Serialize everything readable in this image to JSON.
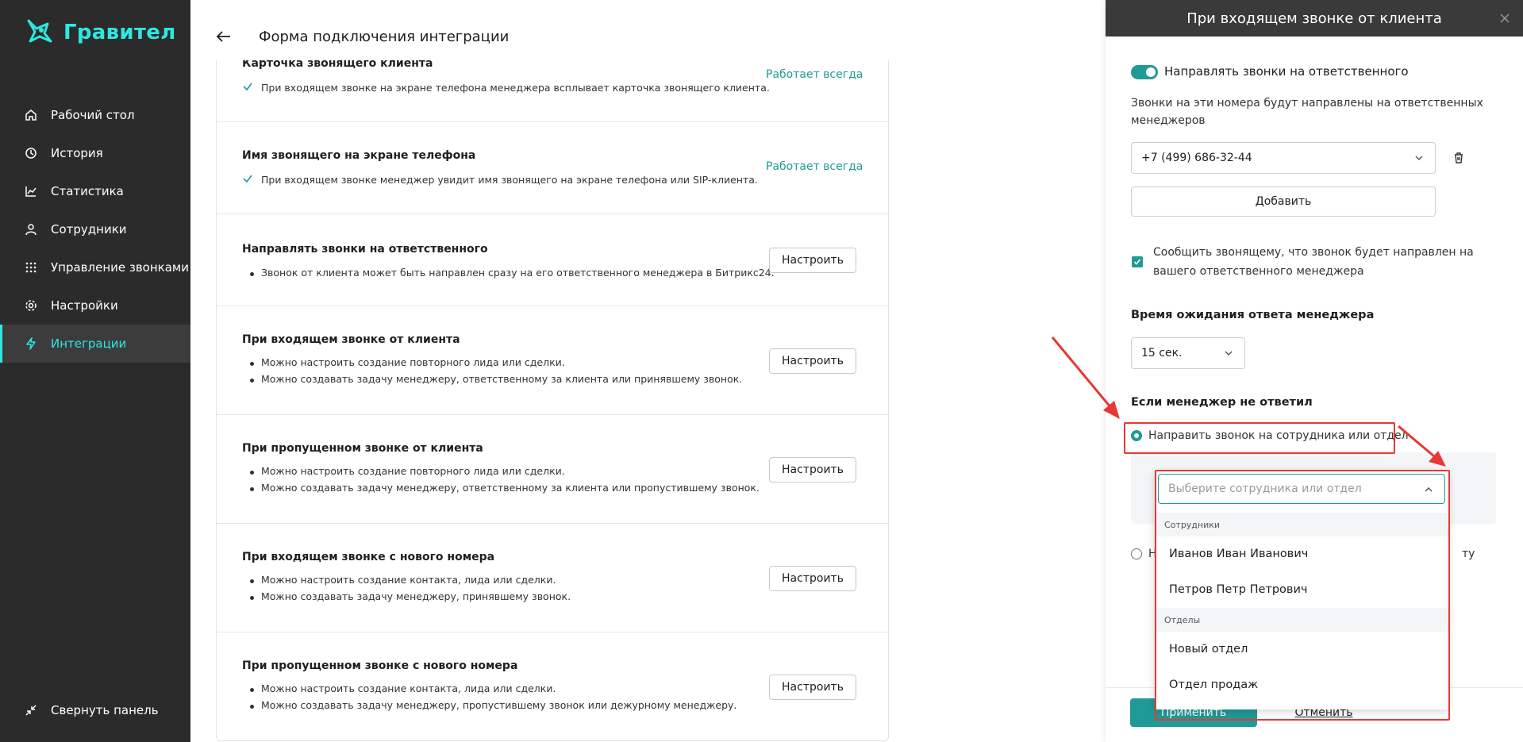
{
  "app": {
    "logo_text": "Гравител"
  },
  "sidebar": {
    "items": [
      {
        "label": "Рабочий стол",
        "icon": "home-icon"
      },
      {
        "label": "История",
        "icon": "history-icon"
      },
      {
        "label": "Статистика",
        "icon": "chart-icon"
      },
      {
        "label": "Сотрудники",
        "icon": "user-icon"
      },
      {
        "label": "Управление звонками",
        "icon": "dialpad-icon"
      },
      {
        "label": "Настройки",
        "icon": "gear-icon"
      },
      {
        "label": "Интеграции",
        "icon": "lightning-icon",
        "active": true
      }
    ],
    "collapse_label": "Свернуть панель"
  },
  "main": {
    "title": "Форма подключения интеграции",
    "always_label": "Работает всегда",
    "config_label": "Настроить",
    "sections": [
      {
        "title": "Карточка звонящего клиента",
        "check": "При входящем звонке на экране телефона менеджера всплывает карточка звонящего клиента."
      },
      {
        "title": "Имя звонящего на экране телефона",
        "check": "При входящем звонке менеджер увидит имя звонящего на экране телефона или SIP-клиента."
      },
      {
        "title": "Направлять звонки на ответственного",
        "bullets": [
          "Звонок от клиента может быть направлен сразу на его ответственного менеджера в Битрикс24."
        ]
      },
      {
        "title": "При входящем звонке от клиента",
        "bullets": [
          "Можно настроить создание повторного лида или сделки.",
          "Можно создавать задачу менеджеру, ответственному за клиента или принявшему звонок."
        ]
      },
      {
        "title": "При пропущенном звонке от клиента",
        "bullets": [
          "Можно настроить создание повторного лида или сделки.",
          "Можно создавать задачу менеджеру, ответственному за клиента или пропустившему звонок."
        ]
      },
      {
        "title": "При входящем звонке с нового номера",
        "bullets": [
          "Можно настроить создание контакта, лида или сделки.",
          "Можно создавать задачу менеджеру, принявшему звонок."
        ]
      },
      {
        "title": "При пропущенном звонке с нового номера",
        "bullets": [
          "Можно настроить создание контакта, лида или сделки.",
          "Можно создавать задачу менеджеру, пропустившему звонок или дежурному менеджеру."
        ]
      }
    ]
  },
  "panel": {
    "title": "При входящем звонке от клиента",
    "toggle_label": "Направлять звонки на ответственного",
    "numbers_hint": "Звонки на эти номера будут направлены на ответственных менеджеров",
    "phone_value": "+7 (499) 686-32-44",
    "add_label": "Добавить",
    "notify_label": "Сообщить звонящему, что звонок будет направлен на вашего ответственного менеджера",
    "wait_title": "Время ожидания ответа менеджера",
    "wait_value": "15 сек.",
    "no_answer_title": "Если менеджер не ответил",
    "radio1_label": "Направить звонок на сотрудника или отдел",
    "radio2_prefix": "Н",
    "radio2_suffix": "ту",
    "apply_label": "Применить",
    "cancel_label": "Отменить"
  },
  "dropdown": {
    "placeholder": "Выберите сотрудника или отдел",
    "group_employees": "Сотрудники",
    "employees": [
      "Иванов Иван Иванович",
      "Петров Петр Петрович"
    ],
    "group_departments": "Отделы",
    "departments": [
      "Новый отдел",
      "Отдел продаж"
    ]
  },
  "colors": {
    "accent": "#1f9a96",
    "logo": "#2ee8e0",
    "sidebar_bg": "#2b2b2b",
    "annotation": "#e53935"
  }
}
